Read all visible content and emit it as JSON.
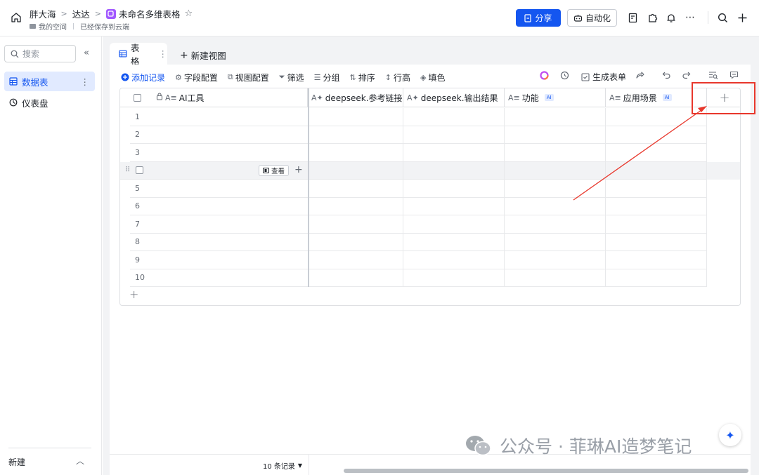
{
  "breadcrumb": {
    "workspace": "胖大海",
    "folder": "达达",
    "doc_title": "未命名多维表格",
    "space": "我的空间",
    "save_status": "已经保存到云端"
  },
  "header": {
    "share_label": "分享",
    "automation_label": "自动化"
  },
  "sidebar": {
    "search_placeholder": "搜索",
    "items": [
      {
        "label": "数据表"
      },
      {
        "label": "仪表盘"
      }
    ],
    "new_label": "新建"
  },
  "tabs": {
    "active": "表格",
    "new_view": "新建视图"
  },
  "toolbar": {
    "add_record": "添加记录",
    "field_config": "字段配置",
    "view_config": "视图配置",
    "filter": "筛选",
    "group": "分组",
    "sort": "排序",
    "row_height": "行高",
    "fill_color": "填色",
    "generate_form": "生成表单"
  },
  "table": {
    "columns": [
      {
        "label": "AI工具",
        "ai": false
      },
      {
        "label": "deepseek.参考链接",
        "ai": false
      },
      {
        "label": "deepseek.输出结果",
        "ai": false
      },
      {
        "label": "功能",
        "ai": true
      },
      {
        "label": "应用场景",
        "ai": true
      }
    ],
    "ai_badge": "AI",
    "rows": [
      "1",
      "2",
      "3",
      "",
      "5",
      "6",
      "7",
      "8",
      "9",
      "10"
    ],
    "view_button": "查看"
  },
  "footer": {
    "records": "10 条记录"
  },
  "watermark": {
    "text": "公众号 · 菲琳AI造梦笔记"
  },
  "colors": {
    "accent": "#1456f0",
    "annotation": "#e8372c"
  }
}
